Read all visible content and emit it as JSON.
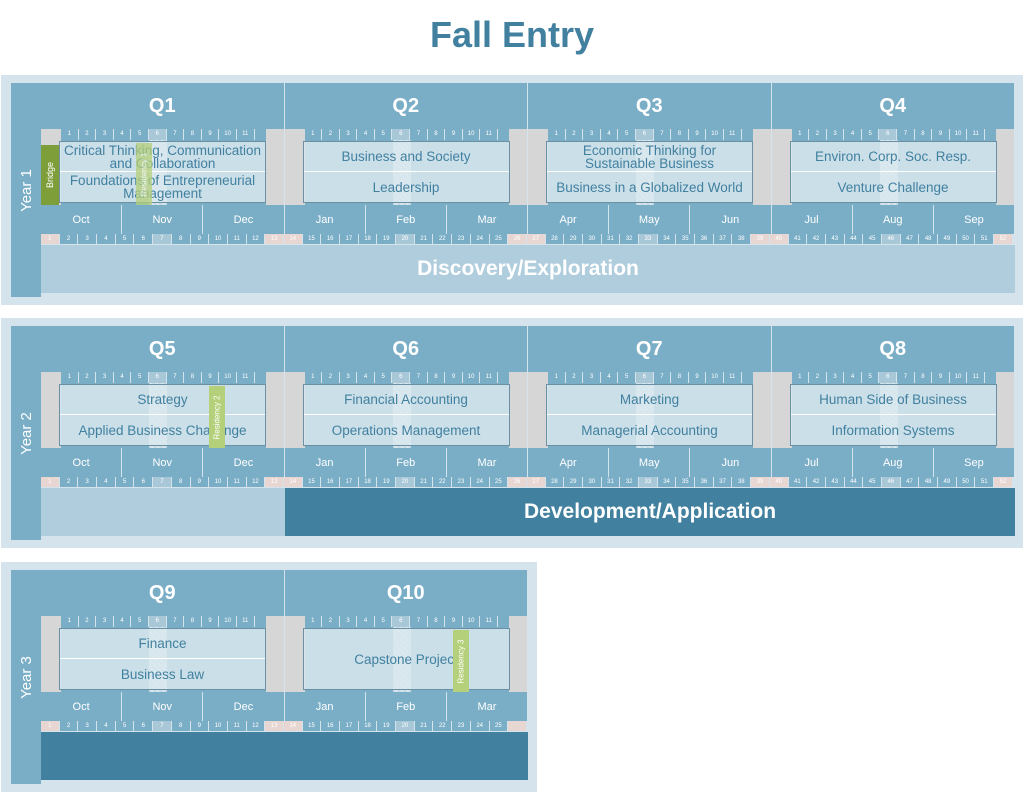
{
  "title": "Fall Entry",
  "years": [
    {
      "label": "Year 1",
      "band": "Discovery/Exploration",
      "quarters": [
        {
          "label": "Q1",
          "courses": [
            "Critical Thinking, Communication and Collaboration",
            "Foundations of Entrepreneurial Management"
          ],
          "months": [
            "Oct",
            "Nov",
            "Dec"
          ]
        },
        {
          "label": "Q2",
          "courses": [
            "Business and Society",
            "Leadership"
          ],
          "months": [
            "Jan",
            "Feb",
            "Mar"
          ]
        },
        {
          "label": "Q3",
          "courses": [
            "Economic Thinking for Sustainable Business",
            "Business in a Globalized World"
          ],
          "months": [
            "Apr",
            "May",
            "Jun"
          ]
        },
        {
          "label": "Q4",
          "courses": [
            "Environ. Corp. Soc. Resp.",
            "Venture Challenge"
          ],
          "months": [
            "Jul",
            "Aug",
            "Sep"
          ]
        }
      ],
      "markers": [
        {
          "label": "Bridge",
          "type": "bridge"
        },
        {
          "label": "Residency 1",
          "type": "residency"
        }
      ]
    },
    {
      "label": "Year 2",
      "band": "Development/Application",
      "quarters": [
        {
          "label": "Q5",
          "courses": [
            "Strategy",
            "Applied Business Challenge"
          ],
          "months": [
            "Oct",
            "Nov",
            "Dec"
          ]
        },
        {
          "label": "Q6",
          "courses": [
            "Financial Accounting",
            "Operations Management"
          ],
          "months": [
            "Jan",
            "Feb",
            "Mar"
          ]
        },
        {
          "label": "Q7",
          "courses": [
            "Marketing",
            "Managerial Accounting"
          ],
          "months": [
            "Apr",
            "May",
            "Jun"
          ]
        },
        {
          "label": "Q8",
          "courses": [
            "Human Side of Business",
            "Information Systems"
          ],
          "months": [
            "Jul",
            "Aug",
            "Sep"
          ]
        }
      ],
      "markers": [
        {
          "label": "Residency 2",
          "type": "residency"
        }
      ]
    },
    {
      "label": "Year 3",
      "band": "",
      "quarters": [
        {
          "label": "Q9",
          "courses": [
            "Finance",
            "Business Law"
          ],
          "months": [
            "Oct",
            "Nov",
            "Dec"
          ]
        },
        {
          "label": "Q10",
          "courses": [
            "Capstone Project"
          ],
          "months": [
            "Jan",
            "Feb",
            "Mar"
          ]
        }
      ],
      "markers": [
        {
          "label": "Residency 3",
          "type": "residency"
        }
      ]
    }
  ],
  "quarter_weeks": [
    "1",
    "2",
    "3",
    "4",
    "5",
    "6",
    "7",
    "8",
    "9",
    "10",
    "11"
  ],
  "year_weeks_count": 52,
  "year3_weeks_count": 25,
  "colors": {
    "title": "#41809f",
    "header": "#7aaec7",
    "band_light": "#b0cddd",
    "band_dark": "#41809f",
    "residency": "#b5d07a",
    "bridge": "#7e9e3a"
  }
}
